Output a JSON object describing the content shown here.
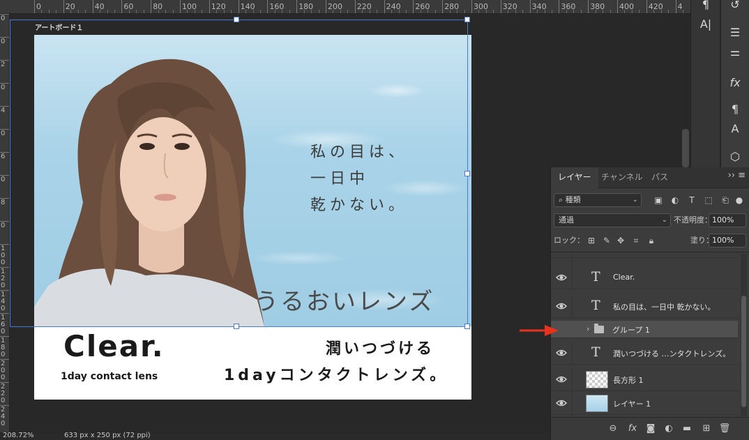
{
  "ruler": {
    "top_labels": [
      "0",
      "20",
      "40",
      "60",
      "80",
      "100",
      "120",
      "140",
      "160",
      "180",
      "200",
      "220",
      "240",
      "260",
      "280",
      "300",
      "320",
      "340",
      "360",
      "380",
      "400",
      "420",
      "4"
    ],
    "left_labels": [
      "0",
      "0",
      "2",
      "0",
      "4",
      "0",
      "6",
      "0",
      "8",
      "0",
      "1 0 0",
      "1 2 0",
      "1 4 0",
      "1 6 0",
      "1 8 0",
      "2 0 0",
      "2 2 0",
      "2 4 0"
    ]
  },
  "artboard": {
    "label": "アートボード１",
    "main_copy": [
      "私の目は、",
      "一日中",
      "乾かない。"
    ],
    "big_copy": "うるおいレンズ",
    "brand": "Clear.",
    "brand_sub": "1day contact lens",
    "tagline_1": "潤いつづける",
    "tagline_2": "1dayコンタクトレンズ。"
  },
  "status": {
    "zoom": "208.72%",
    "doc_size": "633 px x 250 px (72 ppi)"
  },
  "layers_panel": {
    "tabs": [
      "レイヤー",
      "チャンネル",
      "パス"
    ],
    "active_tab": "レイヤー",
    "filter_label": "種類",
    "blend_mode": "通過",
    "opacity_label": "不透明度：",
    "opacity_value": "100%",
    "lock_label": "ロック：",
    "fill_label": "塗り：",
    "fill_value": "100%",
    "layers": [
      {
        "type": "text",
        "name": "Clear."
      },
      {
        "type": "text",
        "name": "私の目は、一日中 乾かない。"
      },
      {
        "type": "group",
        "name": "グループ 1"
      },
      {
        "type": "text",
        "name": "潤いつづける …ンタクトレンズ。"
      },
      {
        "type": "shape",
        "name": "長方形 1"
      },
      {
        "type": "pixel",
        "name": "レイヤー 1"
      }
    ]
  },
  "colors": {
    "selection": "#4a7ad6",
    "arrow": "#e8321e",
    "panel_bg": "#3c3c3c"
  }
}
